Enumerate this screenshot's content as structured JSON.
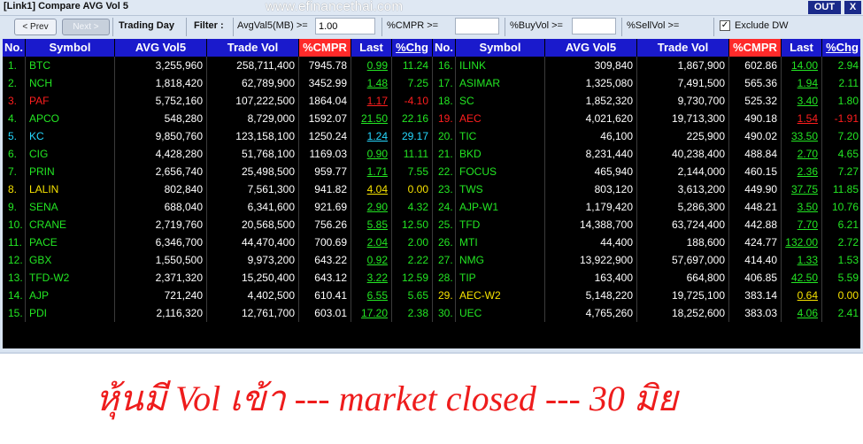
{
  "window": {
    "title": "[Link1] Compare AVG Vol 5",
    "watermark": "www.efinancethai.com",
    "out_label": "OUT",
    "close_label": "X"
  },
  "toolbar": {
    "prev_label": "< Prev",
    "next_label": "Next >",
    "trading_day_label": "Trading Day",
    "filter_label": "Filter :",
    "avgval_label": "AvgVal5(MB) >=",
    "avgval_value": "1.00",
    "cmpr_label": "%CMPR >=",
    "cmpr_value": "",
    "buyvol_label": "%BuyVol >=",
    "buyvol_value": "",
    "sellvol_label": "%SellVol >=",
    "exclude_dw_label": "Exclude DW",
    "exclude_dw_checked": "✓"
  },
  "table": {
    "headers": [
      "No.",
      "Symbol",
      "AVG Vol5",
      "Trade Vol",
      "%CMPR",
      "Last",
      "%Chg"
    ],
    "left_rows": [
      {
        "no": "1.",
        "symbol": "BTC",
        "avg": "3,255,960",
        "trade": "258,711,400",
        "cmpr": "7945.78",
        "last": "0.99",
        "chg": "11.24",
        "color": "g"
      },
      {
        "no": "2.",
        "symbol": "NCH",
        "avg": "1,818,420",
        "trade": "62,789,900",
        "cmpr": "3452.99",
        "last": "1.48",
        "chg": "7.25",
        "color": "g"
      },
      {
        "no": "3.",
        "symbol": "PAF",
        "avg": "5,752,160",
        "trade": "107,222,500",
        "cmpr": "1864.04",
        "last": "1.17",
        "chg": "-4.10",
        "color": "rd"
      },
      {
        "no": "4.",
        "symbol": "APCO",
        "avg": "548,280",
        "trade": "8,729,000",
        "cmpr": "1592.07",
        "last": "21.50",
        "chg": "22.16",
        "color": "g"
      },
      {
        "no": "5.",
        "symbol": "KC",
        "avg": "9,850,760",
        "trade": "123,158,100",
        "cmpr": "1250.24",
        "last": "1.24",
        "chg": "29.17",
        "color": "cy"
      },
      {
        "no": "6.",
        "symbol": "CIG",
        "avg": "4,428,280",
        "trade": "51,768,100",
        "cmpr": "1169.03",
        "last": "0.90",
        "chg": "11.11",
        "color": "g"
      },
      {
        "no": "7.",
        "symbol": "PRIN",
        "avg": "2,656,740",
        "trade": "25,498,500",
        "cmpr": "959.77",
        "last": "1.71",
        "chg": "7.55",
        "color": "g"
      },
      {
        "no": "8.",
        "symbol": "LALIN",
        "avg": "802,840",
        "trade": "7,561,300",
        "cmpr": "941.82",
        "last": "4.04",
        "chg": "0.00",
        "color": "y"
      },
      {
        "no": "9.",
        "symbol": "SENA",
        "avg": "688,040",
        "trade": "6,341,600",
        "cmpr": "921.69",
        "last": "2.90",
        "chg": "4.32",
        "color": "g"
      },
      {
        "no": "10.",
        "symbol": "CRANE",
        "avg": "2,719,760",
        "trade": "20,568,500",
        "cmpr": "756.26",
        "last": "5.85",
        "chg": "12.50",
        "color": "g"
      },
      {
        "no": "11.",
        "symbol": "PACE",
        "avg": "6,346,700",
        "trade": "44,470,400",
        "cmpr": "700.69",
        "last": "2.04",
        "chg": "2.00",
        "color": "g"
      },
      {
        "no": "12.",
        "symbol": "GBX",
        "avg": "1,550,500",
        "trade": "9,973,200",
        "cmpr": "643.22",
        "last": "0.92",
        "chg": "2.22",
        "color": "g"
      },
      {
        "no": "13.",
        "symbol": "TFD-W2",
        "avg": "2,371,320",
        "trade": "15,250,400",
        "cmpr": "643.12",
        "last": "3.22",
        "chg": "12.59",
        "color": "g"
      },
      {
        "no": "14.",
        "symbol": "AJP",
        "avg": "721,240",
        "trade": "4,402,500",
        "cmpr": "610.41",
        "last": "6.55",
        "chg": "5.65",
        "color": "g"
      },
      {
        "no": "15.",
        "symbol": "PDI",
        "avg": "2,116,320",
        "trade": "12,761,700",
        "cmpr": "603.01",
        "last": "17.20",
        "chg": "2.38",
        "color": "g"
      }
    ],
    "right_rows": [
      {
        "no": "16.",
        "symbol": "ILINK",
        "avg": "309,840",
        "trade": "1,867,900",
        "cmpr": "602.86",
        "last": "14.00",
        "chg": "2.94",
        "color": "g"
      },
      {
        "no": "17.",
        "symbol": "ASIMAR",
        "avg": "1,325,080",
        "trade": "7,491,500",
        "cmpr": "565.36",
        "last": "1.94",
        "chg": "2.11",
        "color": "g"
      },
      {
        "no": "18.",
        "symbol": "SC",
        "avg": "1,852,320",
        "trade": "9,730,700",
        "cmpr": "525.32",
        "last": "3.40",
        "chg": "1.80",
        "color": "g"
      },
      {
        "no": "19.",
        "symbol": "AEC",
        "avg": "4,021,620",
        "trade": "19,713,300",
        "cmpr": "490.18",
        "last": "1.54",
        "chg": "-1.91",
        "color": "rd"
      },
      {
        "no": "20.",
        "symbol": "TIC",
        "avg": "46,100",
        "trade": "225,900",
        "cmpr": "490.02",
        "last": "33.50",
        "chg": "7.20",
        "color": "g"
      },
      {
        "no": "21.",
        "symbol": "BKD",
        "avg": "8,231,440",
        "trade": "40,238,400",
        "cmpr": "488.84",
        "last": "2.70",
        "chg": "4.65",
        "color": "g"
      },
      {
        "no": "22.",
        "symbol": "FOCUS",
        "avg": "465,940",
        "trade": "2,144,000",
        "cmpr": "460.15",
        "last": "2.36",
        "chg": "7.27",
        "color": "g"
      },
      {
        "no": "23.",
        "symbol": "TWS",
        "avg": "803,120",
        "trade": "3,613,200",
        "cmpr": "449.90",
        "last": "37.75",
        "chg": "11.85",
        "color": "g"
      },
      {
        "no": "24.",
        "symbol": "AJP-W1",
        "avg": "1,179,420",
        "trade": "5,286,300",
        "cmpr": "448.21",
        "last": "3.50",
        "chg": "10.76",
        "color": "g"
      },
      {
        "no": "25.",
        "symbol": "TFD",
        "avg": "14,388,700",
        "trade": "63,724,400",
        "cmpr": "442.88",
        "last": "7.70",
        "chg": "6.21",
        "color": "g"
      },
      {
        "no": "26.",
        "symbol": "MTI",
        "avg": "44,400",
        "trade": "188,600",
        "cmpr": "424.77",
        "last": "132.00",
        "chg": "2.72",
        "color": "g"
      },
      {
        "no": "27.",
        "symbol": "NMG",
        "avg": "13,922,900",
        "trade": "57,697,000",
        "cmpr": "414.40",
        "last": "1.33",
        "chg": "1.53",
        "color": "g"
      },
      {
        "no": "28.",
        "symbol": "TIP",
        "avg": "163,400",
        "trade": "664,800",
        "cmpr": "406.85",
        "last": "42.50",
        "chg": "5.59",
        "color": "g"
      },
      {
        "no": "29.",
        "symbol": "AEC-W2",
        "avg": "5,148,220",
        "trade": "19,725,100",
        "cmpr": "383.14",
        "last": "0.64",
        "chg": "0.00",
        "color": "y"
      },
      {
        "no": "30.",
        "symbol": "UEC",
        "avg": "4,765,260",
        "trade": "18,252,600",
        "cmpr": "383.03",
        "last": "4.06",
        "chg": "2.41",
        "color": "g"
      }
    ]
  },
  "caption": "หุ้นมี Vol เข้า --- market closed --- 30 มิย"
}
